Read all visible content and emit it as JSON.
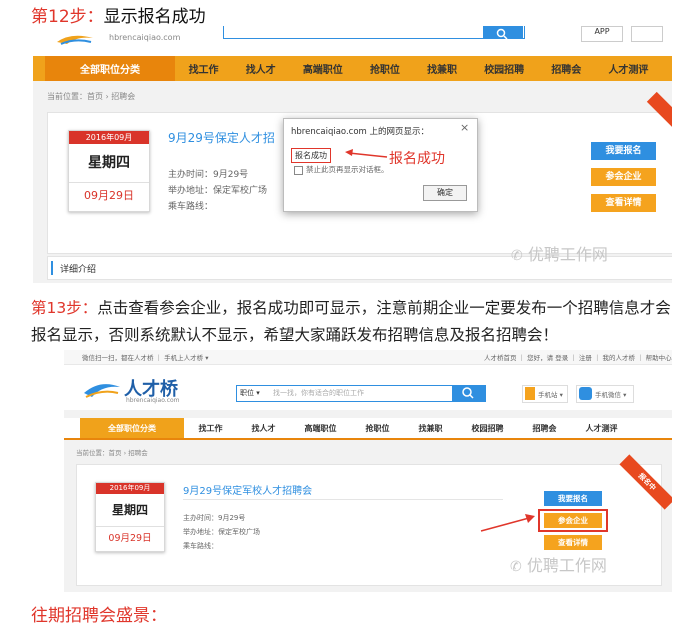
{
  "step12": {
    "num": "第12步：",
    "text": "显示报名成功"
  },
  "shot1": {
    "brand_sub": "hbrencaiqiao.com",
    "search_btn_icon": "search-icon",
    "top_right_btn": "APP",
    "nav_cat": "全部职位分类",
    "nav_items": [
      "找工作",
      "找人才",
      "高端职位",
      "抢职位",
      "找兼职",
      "校园招聘",
      "招聘会",
      "人才测评"
    ],
    "breadcrumb": "当前位置：首页 › 招聘会",
    "cal_month": "2016年09月",
    "cal_day": "星期四",
    "cal_date": "09月29日",
    "fair_title": "9月29号保定人才招",
    "info_time": "主办时间：9月29号",
    "info_place": "举办地址：保定军校广场",
    "info_route": "乘车路线：",
    "btn_apply": "我要报名",
    "btn_companies": "参会企业",
    "btn_details": "查看详情",
    "dialog_title": "hbrencaiqiao.com 上的网页显示：",
    "dialog_close": "×",
    "dialog_msg": "报名成功",
    "dialog_checkbox": "禁止此页再显示对话框。",
    "dialog_ok": "确定",
    "annotation": "报名成功",
    "detail_tab": "详细介绍",
    "watermark": "优聘工作网"
  },
  "step13": {
    "num": "第13步：",
    "text": "点击查看参会企业，报名成功即可显示，注意前期企业一定要发布一个招聘信息才会",
    "text2": "报名显示，否则系统默认不显示，希望大家踊跃发布招聘信息及报名招聘会！"
  },
  "shot2": {
    "topbar_left": "微信扫一扫，都在人才桥 ｜ 手机上人才桥 ▾",
    "topbar_right": "人才桥首页 ｜ 您好，请 登录 ｜ 注册 ｜ 我的人才桥 ｜ 帮助中心",
    "logo_text": "人才桥",
    "logo_sub": "hbrencaiqiao.com",
    "search_select": "职位 ▾",
    "search_placeholder": "找一找，你有适合的职位工作",
    "search_icon": "search-icon",
    "mobile_btn": "手机站 ▾",
    "wechat_btn": "手机微信 ▾",
    "nav_cat": "全部职位分类",
    "nav_items": [
      "找工作",
      "找人才",
      "高端职位",
      "抢职位",
      "找兼职",
      "校园招聘",
      "招聘会",
      "人才测评"
    ],
    "breadcrumb": "当前位置：首页 › 招聘会",
    "cal_month": "2016年09月",
    "cal_day": "星期四",
    "cal_date": "09月29日",
    "fair_title": "9月29号保定军校人才招聘会",
    "info_time": "主办时间：9月29号",
    "info_place": "举办地址：保定军校广场",
    "info_route": "乘车路线：",
    "btn_apply": "我要报名",
    "btn_companies": "参会企业",
    "btn_details": "查看详情",
    "ribbon": "报名中",
    "watermark": "优聘工作网"
  },
  "footer": {
    "text": "往期招聘会盛景："
  },
  "colors": {
    "accent_red": "#e0362b",
    "nav_orange": "#f0a21b",
    "btn_blue": "#2f8fe0",
    "btn_orange": "#f5a31e"
  }
}
